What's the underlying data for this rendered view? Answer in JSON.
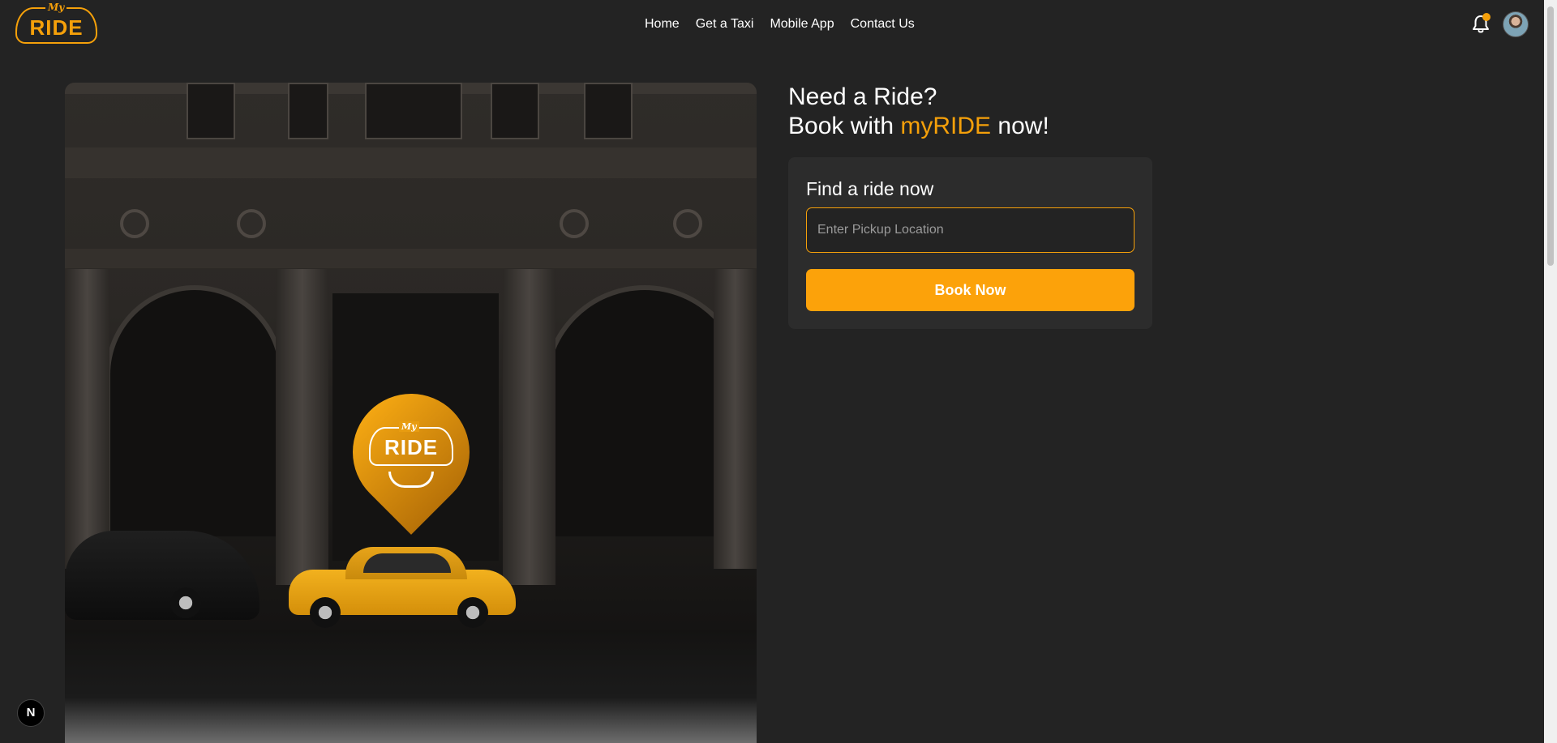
{
  "header": {
    "logo": {
      "top_text": "My",
      "main_text": "RIDE"
    },
    "nav": [
      {
        "label": "Home"
      },
      {
        "label": "Get a Taxi"
      },
      {
        "label": "Mobile App"
      },
      {
        "label": "Contact Us"
      }
    ],
    "icons": {
      "notification": "bell-icon",
      "profile": "avatar"
    }
  },
  "hero": {
    "pin_logo": {
      "top_text": "My",
      "main_text": "RIDE"
    }
  },
  "booking": {
    "headline_line1": "Need a Ride?",
    "headline_prefix": "Book with ",
    "headline_brand": "myRIDE",
    "headline_suffix": " now!",
    "card_title": "Find a ride now",
    "pickup_placeholder": "Enter Pickup Location",
    "pickup_value": "",
    "button_label": "Book Now"
  },
  "dev_badge": {
    "label": "N"
  },
  "colors": {
    "accent": "#f5a00a",
    "button": "#fca20a",
    "background": "#232323",
    "card": "#2c2c2c"
  }
}
